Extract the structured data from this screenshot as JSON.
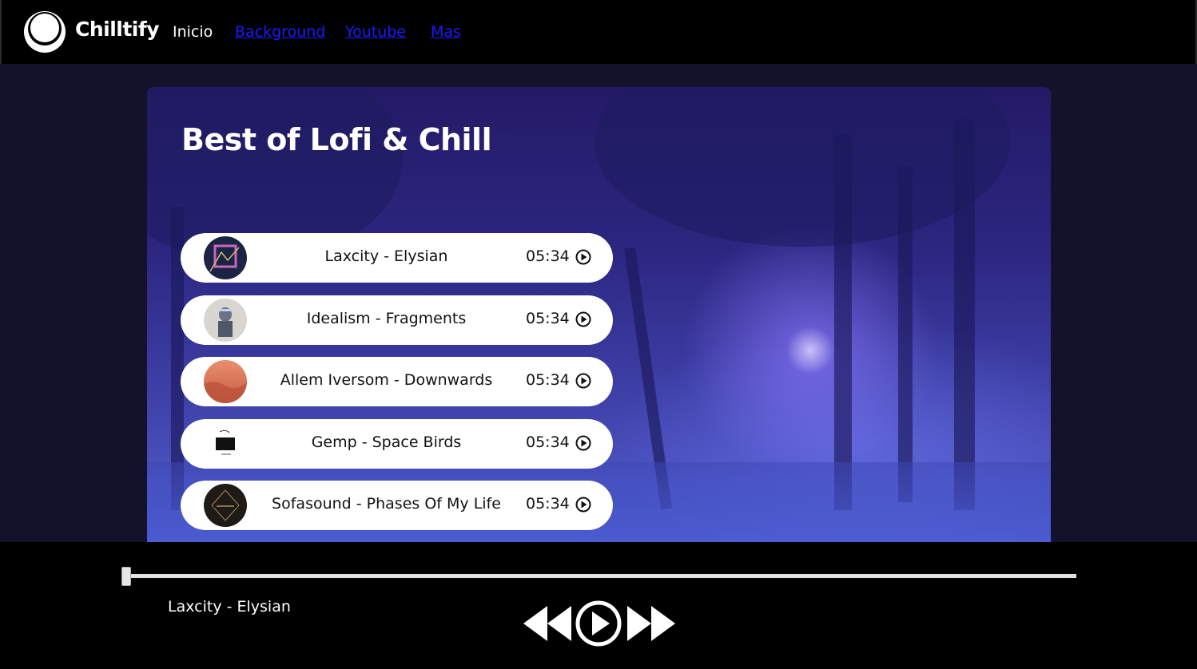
{
  "nav": {
    "brand": "Chilltify",
    "links": [
      "Inicio",
      "Background",
      "Youtube",
      "Mas"
    ]
  },
  "hero": {
    "title": "Best of Lofi & Chill",
    "tracks": [
      {
        "name": "Laxcity - Elysian",
        "duration": "05:34",
        "cover": "laxcity-cover"
      },
      {
        "name": "Idealism - Fragments",
        "duration": "05:34",
        "cover": "idealism-cover"
      },
      {
        "name": "Allem Iversom - Downwards",
        "duration": "05:34",
        "cover": "allem-cover"
      },
      {
        "name": "Gemp - Space Birds",
        "duration": "05:34",
        "cover": "gemp-cover"
      },
      {
        "name": "Sofasound - Phases Of My Life",
        "duration": "05:34",
        "cover": "sofasound-cover"
      }
    ]
  },
  "player": {
    "now_playing": "Laxcity - Elysian",
    "progress": 0.0
  },
  "colors": {
    "nav_bg": "#000000",
    "page_bg": "#14122b",
    "link": "#1a1aff",
    "track_bg": "#ffffff"
  }
}
